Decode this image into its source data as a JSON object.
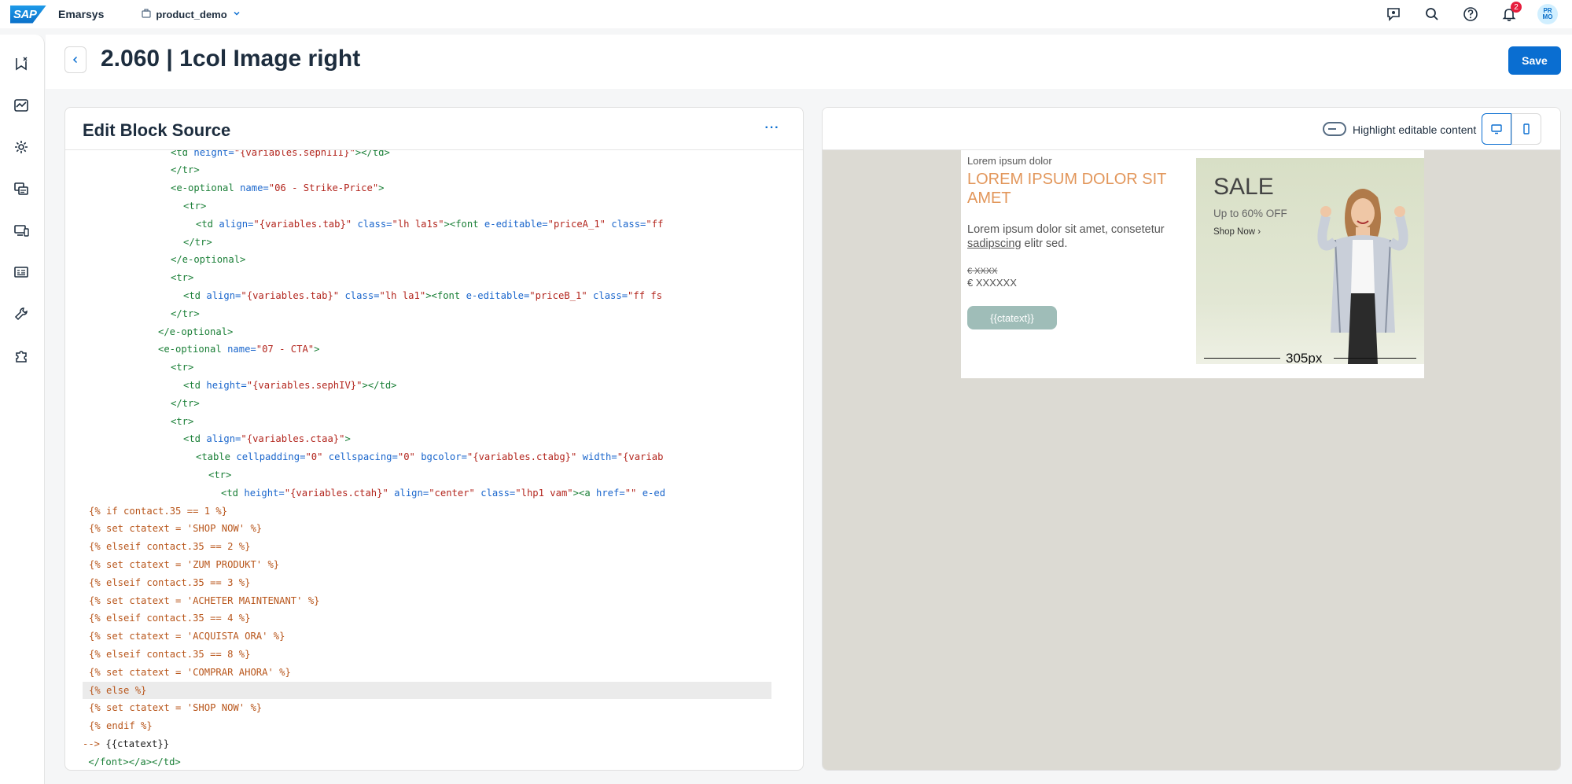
{
  "shell": {
    "brand": "Emarsys",
    "account": "product_demo",
    "notif_count": "2",
    "avatar_initials": "PR MO",
    "logo_text": "SAP"
  },
  "page": {
    "title": "2.060 | 1col Image right",
    "save_label": "Save"
  },
  "editor": {
    "title": "Edit Block Source",
    "more_label": "···"
  },
  "code_lines": [
    [
      [
        14,
        "tag",
        "<td "
      ],
      [
        0,
        "attr",
        "height="
      ],
      [
        0,
        "str",
        "\"{variables.sephIII}\""
      ],
      [
        0,
        "tag",
        "></td>"
      ]
    ],
    [
      [
        14,
        "tag",
        "</tr>"
      ]
    ],
    [
      [
        14,
        "tag",
        "<e-optional "
      ],
      [
        0,
        "attr",
        "name="
      ],
      [
        0,
        "str",
        "\"06 - Strike-Price\""
      ],
      [
        0,
        "tag",
        ">"
      ]
    ],
    [
      [
        16,
        "tag",
        "<tr>"
      ]
    ],
    [
      [
        18,
        "tag",
        "<td "
      ],
      [
        0,
        "attr",
        "align="
      ],
      [
        0,
        "str",
        "\"{variables.tab}\" "
      ],
      [
        0,
        "attr",
        "class="
      ],
      [
        0,
        "str",
        "\"lh la1s\""
      ],
      [
        0,
        "tag",
        "><font "
      ],
      [
        0,
        "attr",
        "e-editable="
      ],
      [
        0,
        "str",
        "\"priceA_1\" "
      ],
      [
        0,
        "attr",
        "class="
      ],
      [
        0,
        "str",
        "\"ff"
      ]
    ],
    [
      [
        16,
        "tag",
        "</tr>"
      ]
    ],
    [
      [
        14,
        "tag",
        "</e-optional>"
      ]
    ],
    [
      [
        14,
        "tag",
        "<tr>"
      ]
    ],
    [
      [
        16,
        "tag",
        "<td "
      ],
      [
        0,
        "attr",
        "align="
      ],
      [
        0,
        "str",
        "\"{variables.tab}\" "
      ],
      [
        0,
        "attr",
        "class="
      ],
      [
        0,
        "str",
        "\"lh la1\""
      ],
      [
        0,
        "tag",
        "><font "
      ],
      [
        0,
        "attr",
        "e-editable="
      ],
      [
        0,
        "str",
        "\"priceB_1\" "
      ],
      [
        0,
        "attr",
        "class="
      ],
      [
        0,
        "str",
        "\"ff fs"
      ]
    ],
    [
      [
        14,
        "tag",
        "</tr>"
      ]
    ],
    [
      [
        12,
        "tag",
        "</e-optional>"
      ]
    ],
    [
      [
        12,
        "tag",
        "<e-optional "
      ],
      [
        0,
        "attr",
        "name="
      ],
      [
        0,
        "str",
        "\"07 - CTA\""
      ],
      [
        0,
        "tag",
        ">"
      ]
    ],
    [
      [
        14,
        "tag",
        "<tr>"
      ]
    ],
    [
      [
        16,
        "tag",
        "<td "
      ],
      [
        0,
        "attr",
        "height="
      ],
      [
        0,
        "str",
        "\"{variables.sephIV}\""
      ],
      [
        0,
        "tag",
        "></td>"
      ]
    ],
    [
      [
        14,
        "tag",
        "</tr>"
      ]
    ],
    [
      [
        14,
        "tag",
        "<tr>"
      ]
    ],
    [
      [
        16,
        "tag",
        "<td "
      ],
      [
        0,
        "attr",
        "align="
      ],
      [
        0,
        "str",
        "\"{variables.ctaa}\""
      ],
      [
        0,
        "tag",
        ">"
      ]
    ],
    [
      [
        18,
        "tag",
        "<table "
      ],
      [
        0,
        "attr",
        "cellpadding="
      ],
      [
        0,
        "str",
        "\"0\" "
      ],
      [
        0,
        "attr",
        "cellspacing="
      ],
      [
        0,
        "str",
        "\"0\" "
      ],
      [
        0,
        "attr",
        "bgcolor="
      ],
      [
        0,
        "str",
        "\"{variables.ctabg}\" "
      ],
      [
        0,
        "attr",
        "width="
      ],
      [
        0,
        "str",
        "\"{variab"
      ]
    ],
    [
      [
        20,
        "tag",
        "<tr>"
      ]
    ],
    [
      [
        22,
        "tag",
        "<td "
      ],
      [
        0,
        "attr",
        "height="
      ],
      [
        0,
        "str",
        "\"{variables.ctah}\" "
      ],
      [
        0,
        "attr",
        "align="
      ],
      [
        0,
        "str",
        "\"center\" "
      ],
      [
        0,
        "attr",
        "class="
      ],
      [
        0,
        "str",
        "\"lhp1 vam\""
      ],
      [
        0,
        "tag",
        "><a "
      ],
      [
        0,
        "attr",
        "href="
      ],
      [
        0,
        "str",
        "\"\" "
      ],
      [
        0,
        "attr",
        "e-ed"
      ]
    ],
    [
      [
        1,
        "tpl",
        "{% if contact.35 == 1 %}"
      ]
    ],
    [
      [
        1,
        "tpl",
        "{% set ctatext = 'SHOP NOW' %}"
      ]
    ],
    [
      [
        1,
        "tpl",
        "{% elseif contact.35 == 2 %}"
      ]
    ],
    [
      [
        1,
        "tpl",
        "{% set ctatext = 'ZUM PRODUKT' %}"
      ]
    ],
    [
      [
        1,
        "tpl",
        "{% elseif contact.35 == 3 %}"
      ]
    ],
    [
      [
        1,
        "tpl",
        "{% set ctatext = 'ACHETER MAINTENANT' %}"
      ]
    ],
    [
      [
        1,
        "tpl",
        "{% elseif contact.35 == 4 %}"
      ]
    ],
    [
      [
        1,
        "tpl",
        "{% set ctatext = 'ACQUISTA ORA' %}"
      ]
    ],
    [
      [
        1,
        "tpl",
        "{% elseif contact.35 == 8 %}"
      ]
    ],
    [
      [
        1,
        "tpl",
        "{% set ctatext = 'COMPRAR AHORA' %}"
      ]
    ],
    [
      [
        1,
        "tpl",
        "{% else %}"
      ]
    ],
    [
      [
        1,
        "tpl",
        "{% set ctatext = 'SHOP NOW' %}"
      ]
    ],
    [
      [
        1,
        "tpl",
        "{% endif %}"
      ]
    ],
    [
      [
        0,
        "tpl",
        "--> "
      ],
      [
        0,
        "plain",
        "{{ctatext}}"
      ]
    ],
    [
      [
        0,
        "plain",
        " "
      ],
      [
        0,
        "tag",
        "</font></a></td>"
      ]
    ]
  ],
  "highlighted_line": 30,
  "preview": {
    "highlight_label": "Highlight editable content",
    "kicker": "Lorem ipsum dolor",
    "headline": "LOREM IPSUM DOLOR SIT AMET",
    "body_prefix": "Lorem ipsum dolor sit amet, consetetur ",
    "body_link": "sadipscing",
    "body_suffix": " elitr sed.",
    "strike_price": "€ XXXX",
    "price": "€ XXXXXX",
    "cta": "{{ctatext}}",
    "sale_title": "SALE",
    "sale_sub": "Up to 60% OFF",
    "sale_shop": "Shop Now ›",
    "ruler_label": "305px"
  },
  "colors": {
    "accent": "#0a6ed1",
    "headline": "#e2965a",
    "cta": "#9fbdb8",
    "canvas": "#dcdad3"
  }
}
